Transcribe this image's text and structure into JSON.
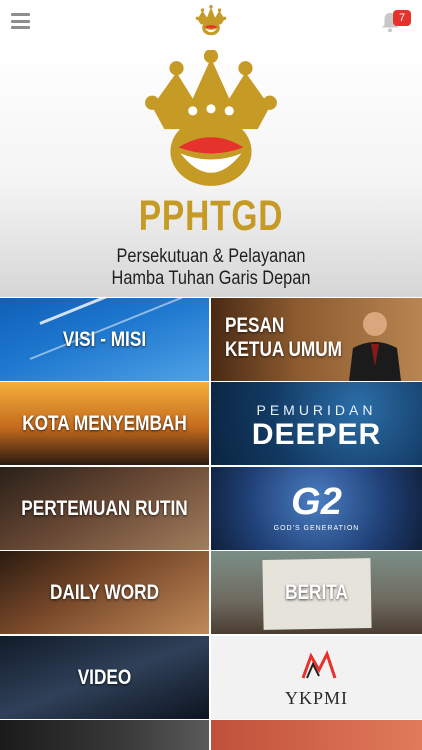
{
  "header": {
    "menu_icon": "hamburger-menu-icon",
    "logo_icon": "crown-logo-icon",
    "notification_icon": "bell-icon",
    "notification_count": "7"
  },
  "hero": {
    "brand": "PPHTGD",
    "subtitle_line1": "Persekutuan & Pelayanan",
    "subtitle_line2": "Hamba Tuhan Garis Depan",
    "colors": {
      "gold": "#c59a25",
      "red": "#e5322d"
    }
  },
  "menu": {
    "visi_misi": "VISI - MISI",
    "pesan_line1": "PESAN",
    "pesan_line2": "KETUA UMUM",
    "kota_menyembah": "KOTA MENYEMBAH",
    "pemuridan": "PEMURIDAN",
    "deeper": "DEEPER",
    "pertemuan_rutin": "PERTEMUAN RUTIN",
    "g2": "G2",
    "g2_sub": "GOD'S GENERATION",
    "daily_word": "DAILY WORD",
    "berita": "BERITA",
    "video": "VIDEO",
    "ykpmi": "YKPMI"
  }
}
